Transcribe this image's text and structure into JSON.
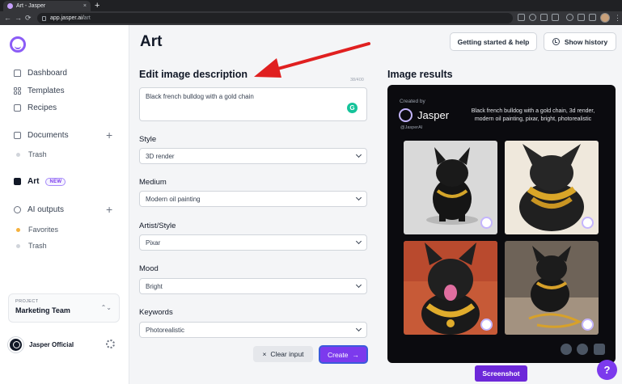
{
  "browser": {
    "tab_title": "Art - Jasper",
    "tab_close": "×",
    "new_tab": "+",
    "url_host": "app.jasper.ai/",
    "url_path": "art",
    "back": "←",
    "forward": "→",
    "reload": "⟳",
    "menu": "⋮"
  },
  "sidebar": {
    "nav": [
      {
        "label": "Dashboard",
        "icon": "home-icon"
      },
      {
        "label": "Templates",
        "icon": "grid-icon"
      },
      {
        "label": "Recipes",
        "icon": "recipe-icon"
      }
    ],
    "documents": {
      "label": "Documents",
      "add": "+",
      "items": [
        "Trash"
      ]
    },
    "art": {
      "label": "Art",
      "badge": "NEW"
    },
    "ai_outputs": {
      "label": "AI outputs",
      "add": "+",
      "items": [
        "Favorites",
        "Trash"
      ]
    },
    "project": {
      "caption": "PROJECT",
      "name": "Marketing Team",
      "chevron": "⌃⌄"
    },
    "user": {
      "name": "Jasper Official"
    }
  },
  "header": {
    "title": "Art",
    "getting_started": "Getting started & help",
    "show_history": "Show history"
  },
  "editor": {
    "title": "Edit image description",
    "counter": "38/400",
    "description": "Black french bulldog with a gold chain",
    "grammarly": "G",
    "fields": [
      {
        "label": "Style",
        "value": "3D render"
      },
      {
        "label": "Medium",
        "value": "Modern oil painting"
      },
      {
        "label": "Artist/Style",
        "value": "Pixar"
      },
      {
        "label": "Mood",
        "value": "Bright"
      },
      {
        "label": "Keywords",
        "value": "Photorealistic"
      }
    ],
    "clear_label": "Clear input",
    "clear_icon": "×",
    "create_label": "Create",
    "create_icon": "→"
  },
  "results": {
    "title": "Image results",
    "created_by": "Created by",
    "brand": "Jasper",
    "handle": "@JasperAI",
    "prompt": "Black french bulldog with a gold chain, 3d render, modern oil painting, pixar, bright, photorealistic"
  },
  "footer": {
    "screenshot": "Screenshot",
    "help": "?"
  },
  "colors": {
    "accent": "#7c3aed",
    "results_bg": "#0b0b0f",
    "annotation_arrow": "#e02020"
  }
}
